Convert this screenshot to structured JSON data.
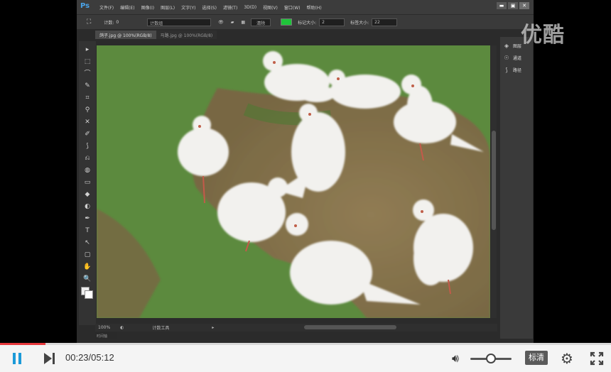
{
  "photoshop": {
    "logo": "Ps",
    "menus": [
      "文件(F)",
      "编辑(E)",
      "图像(I)",
      "图层(L)",
      "文字(Y)",
      "选择(S)",
      "滤镜(T)",
      "3D(D)",
      "视图(V)",
      "窗口(W)",
      "帮助(H)"
    ],
    "window_buttons": [
      "▬",
      "▣",
      "✕"
    ],
    "options": {
      "tool_glyph": "⛶",
      "count_label": "计数:",
      "count_value": "0",
      "group_value": "计数组",
      "clear_label": "清除",
      "marker_color": "#1fc43a",
      "marker_size_label": "标记大小:",
      "marker_size_value": "2",
      "label_size_label": "标签大小:",
      "label_size_value": "22"
    },
    "tabs": [
      {
        "label": "鸽子.jpg @ 100%(RGB/8)",
        "active": true
      },
      {
        "label": "马路.jpg @ 100%(RGB/8)",
        "active": false
      }
    ],
    "tools": [
      "▸",
      "⬚",
      "⌒",
      "✎",
      "⌗",
      "⚲",
      "✕",
      "✐",
      "⟆",
      "⎌",
      "◍",
      "▭",
      "◆",
      "◐",
      "✒",
      "T",
      "↖",
      "▢",
      "✋",
      "🔍"
    ],
    "panel": [
      {
        "icon": "layers-icon",
        "glyph": "◈",
        "label": "图层"
      },
      {
        "icon": "channels-icon",
        "glyph": "☉",
        "label": "通道"
      },
      {
        "icon": "paths-icon",
        "glyph": "⟆",
        "label": "路径"
      }
    ],
    "status": {
      "zoom": "100%",
      "info": "计数工具"
    },
    "mini_bridge": "时间轴",
    "canvas_colors": {
      "grass": "#5c8a3e",
      "dirt": "#8a6a4a",
      "bird": "#f2f1ee"
    }
  },
  "watermark": "优酷",
  "player": {
    "progress": 0.074,
    "current_time": "00:23",
    "duration": "05:12",
    "time_display": "00:23/05:12",
    "volume": 0.5,
    "quality_label": "标清",
    "accent_color": "#1c9ad8",
    "progress_color": "#e8393d"
  }
}
